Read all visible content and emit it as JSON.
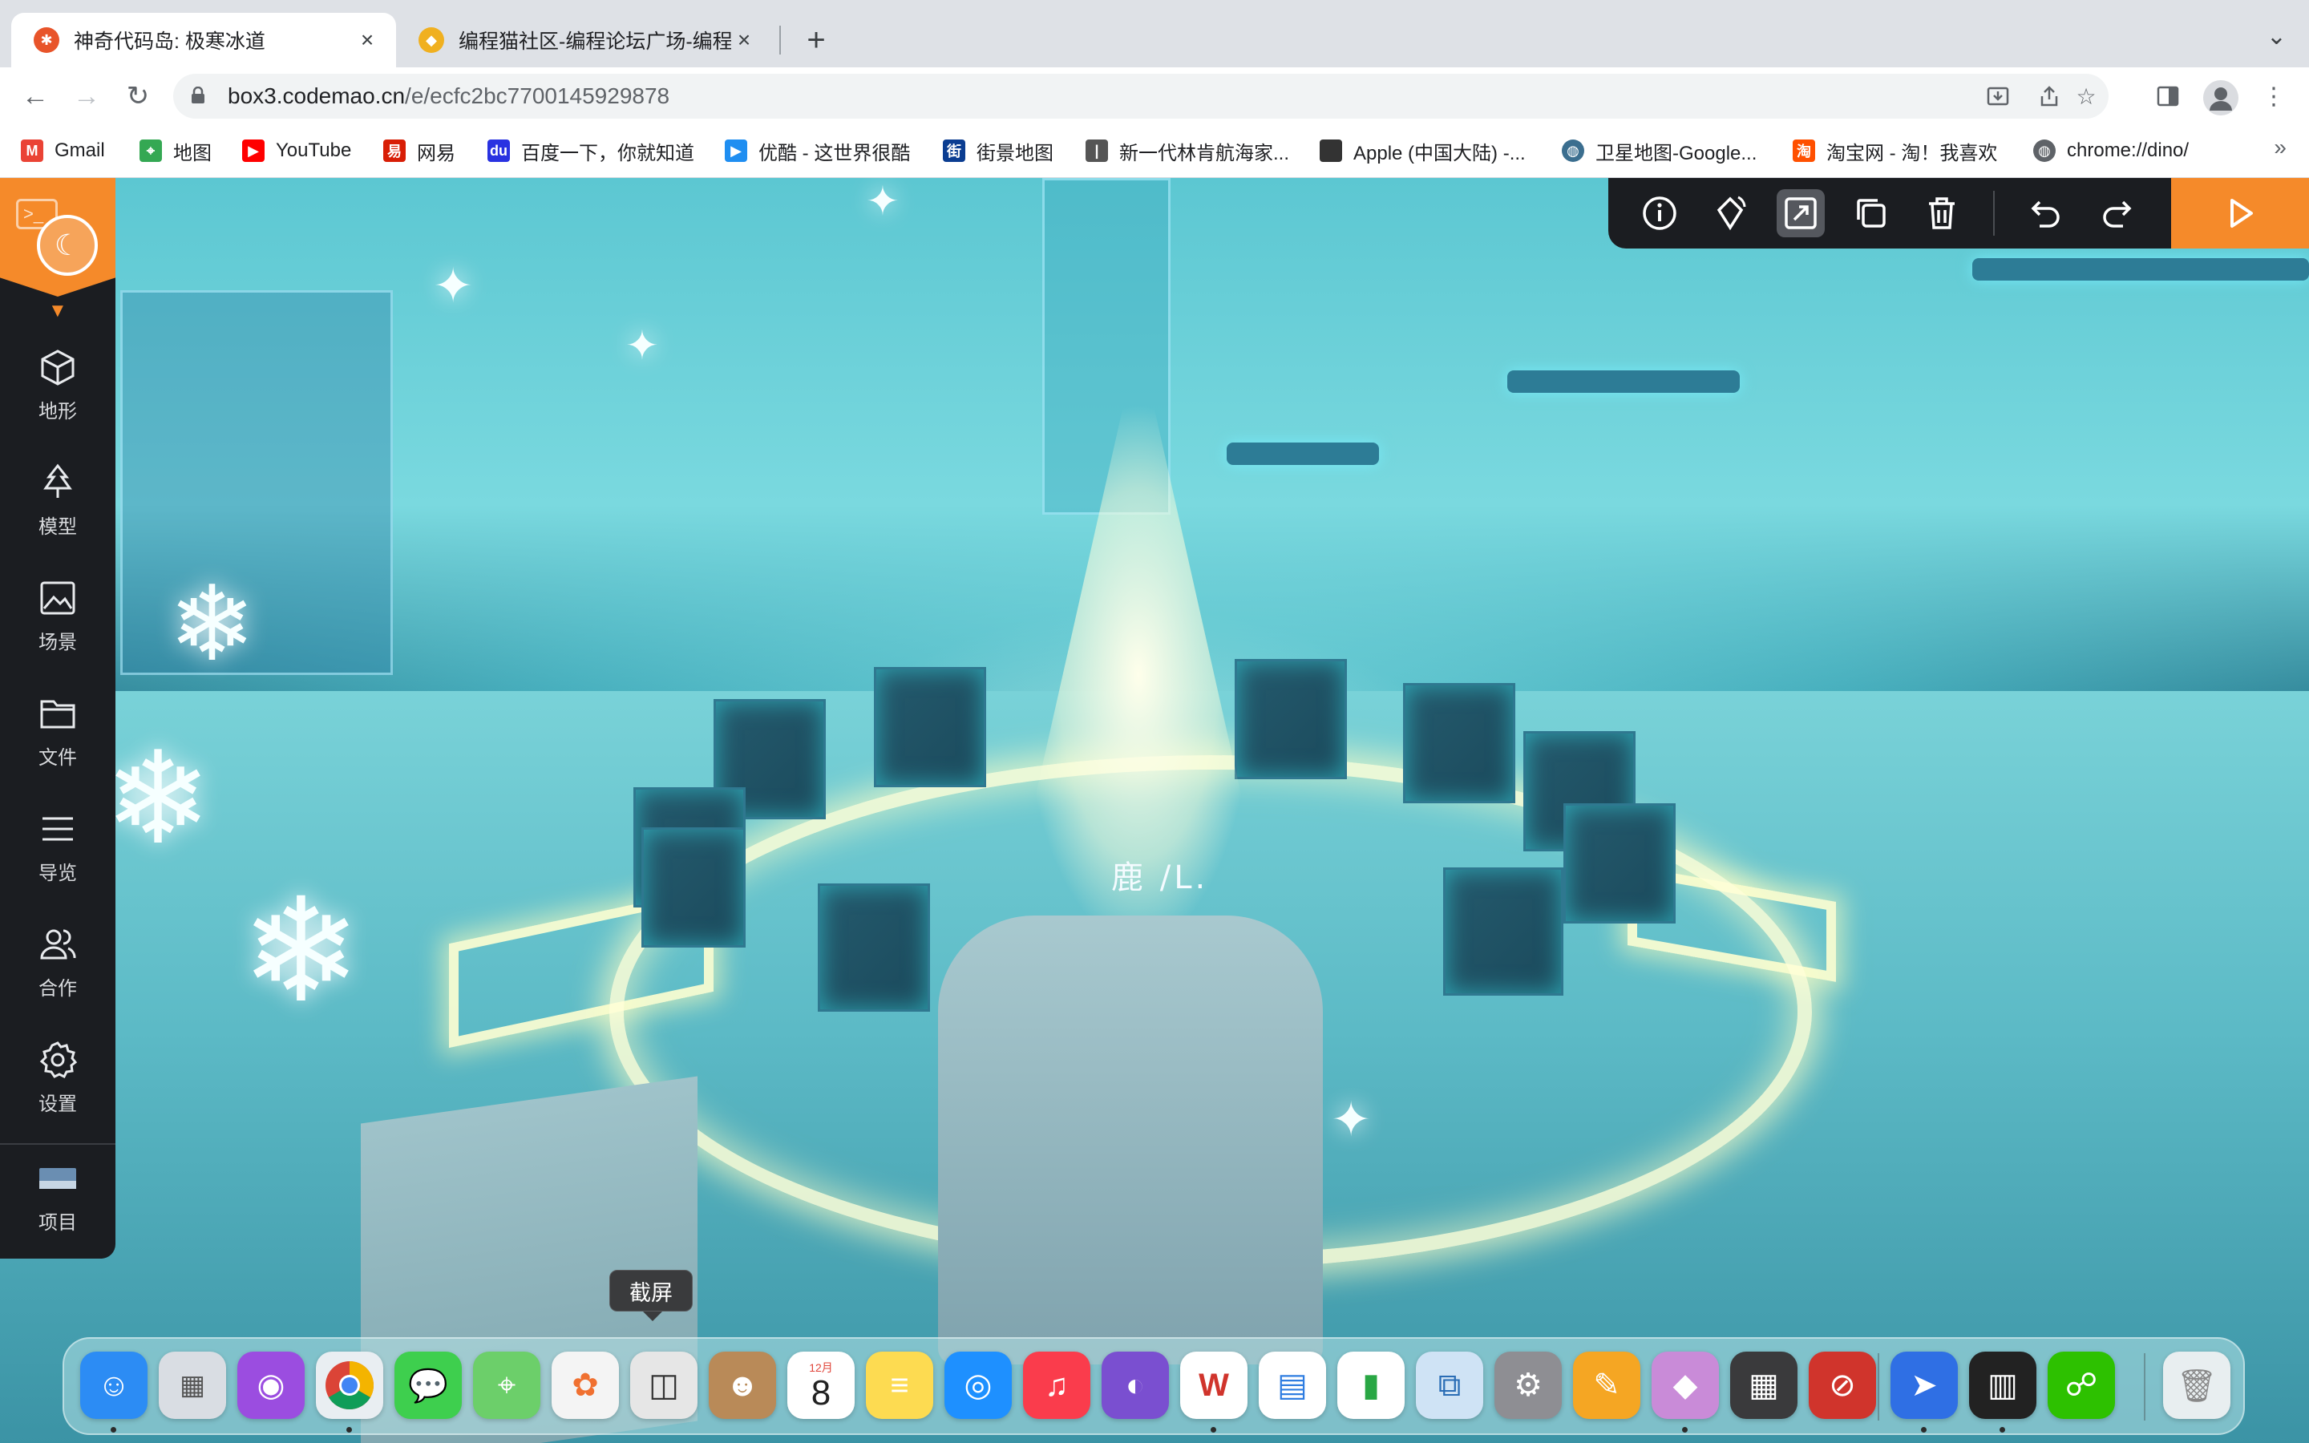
{
  "browser": {
    "tabs": [
      {
        "title": "神奇代码岛: 极寒冰道",
        "active": true,
        "favicon": "codemao-star-icon"
      },
      {
        "title": "编程猫社区-编程论坛广场-编程学",
        "active": false,
        "favicon": "codemao-cat-icon"
      }
    ],
    "new_tab_label": "+",
    "url_host": "box3.codemao.cn",
    "url_path": "/e/ecfc2bc7700145929878",
    "bookmarks": [
      {
        "label": "Gmail",
        "icon": "gmail-icon",
        "color": "#ea4335"
      },
      {
        "label": "地图",
        "icon": "maps-icon",
        "color": "#34a853"
      },
      {
        "label": "YouTube",
        "icon": "youtube-icon",
        "color": "#ff0000"
      },
      {
        "label": "网易",
        "icon": "netease-icon",
        "color": "#d81e06"
      },
      {
        "label": "百度一下，你就知道",
        "icon": "baidu-icon",
        "color": "#2932e1"
      },
      {
        "label": "优酷 - 这世界很酷",
        "icon": "youku-icon",
        "color": "#1f8ef1"
      },
      {
        "label": "街景地图",
        "icon": "street-map-icon",
        "color": "#0b3d91"
      },
      {
        "label": "新一代林肯航海家...",
        "icon": "lincoln-icon",
        "color": "#555555"
      },
      {
        "label": "Apple (中国大陆) -...",
        "icon": "apple-icon",
        "color": "#333333"
      },
      {
        "label": "卫星地图-Google...",
        "icon": "globe-icon",
        "color": "#3b6e8f"
      },
      {
        "label": "淘宝网 - 淘！我喜欢",
        "icon": "taobao-icon",
        "color": "#ff5000"
      },
      {
        "label": "chrome://dino/",
        "icon": "chrome-globe-icon",
        "color": "#5f6368"
      }
    ],
    "bookmarks_more": "»"
  },
  "editor": {
    "rail": [
      {
        "label": "地形",
        "icon": "cube-icon"
      },
      {
        "label": "模型",
        "icon": "tree-icon"
      },
      {
        "label": "场景",
        "icon": "image-icon"
      },
      {
        "label": "文件",
        "icon": "folder-icon"
      },
      {
        "label": "导览",
        "icon": "list-icon"
      },
      {
        "label": "合作",
        "icon": "people-icon"
      },
      {
        "label": "设置",
        "icon": "gear-icon"
      },
      {
        "label": "项目",
        "icon": "project-thumbnail-icon"
      }
    ],
    "toolbar": [
      "info-icon",
      "rotate-icon",
      "resize-icon",
      "duplicate-icon",
      "delete-icon",
      "undo-icon",
      "redo-icon"
    ],
    "play_icon": "play-icon",
    "accent_color": "#f58a2a",
    "panel_color": "#1b1d21"
  },
  "scene": {
    "caption": "鹿 /L."
  },
  "tooltip": "截屏",
  "dock": {
    "apps": [
      {
        "name": "finder",
        "icon": "finder-icon",
        "color": "#2c8cf4",
        "running": true
      },
      {
        "name": "launchpad",
        "icon": "launchpad-icon",
        "color": "#d9dde3",
        "running": false
      },
      {
        "name": "podcasts",
        "icon": "podcasts-icon",
        "color": "#9b4de0",
        "running": false
      },
      {
        "name": "chrome",
        "icon": "chrome-icon",
        "color": "#e9eef2",
        "running": true
      },
      {
        "name": "messages",
        "icon": "messages-icon",
        "color": "#3ecf4e",
        "running": false
      },
      {
        "name": "maps",
        "icon": "maps-app-icon",
        "color": "#6ccf6a",
        "running": false
      },
      {
        "name": "photos",
        "icon": "photos-icon",
        "color": "#f4f4f4",
        "running": false
      },
      {
        "name": "screenshot",
        "icon": "screenshot-icon",
        "color": "#e6e6e6",
        "running": false
      },
      {
        "name": "contacts",
        "icon": "contacts-icon",
        "color": "#b98a58",
        "running": false
      },
      {
        "name": "calendar",
        "icon": "calendar-icon",
        "color": "#ffffff",
        "running": false,
        "month": "12月",
        "day": "8"
      },
      {
        "name": "notes",
        "icon": "notes-icon",
        "color": "#fddb51",
        "running": false
      },
      {
        "name": "safari",
        "icon": "safari-icon",
        "color": "#1e90ff",
        "running": false
      },
      {
        "name": "music",
        "icon": "music-icon",
        "color": "#fa3c4c",
        "running": false
      },
      {
        "name": "instruments",
        "icon": "instruments-icon",
        "color": "#7a4fd0",
        "running": false
      },
      {
        "name": "wps",
        "icon": "wps-icon",
        "color": "#ffffff",
        "running": true
      },
      {
        "name": "keynote",
        "icon": "keynote-icon",
        "color": "#ffffff",
        "running": false
      },
      {
        "name": "numbers",
        "icon": "numbers-icon",
        "color": "#ffffff",
        "running": false
      },
      {
        "name": "screen-sharing",
        "icon": "screen-sharing-icon",
        "color": "#cfe3f5",
        "running": false
      },
      {
        "name": "system-preferences",
        "icon": "system-preferences-icon",
        "color": "#8e8e93",
        "running": false
      },
      {
        "name": "pages",
        "icon": "pages-icon",
        "color": "#f5a623",
        "running": false
      },
      {
        "name": "magicavoxel",
        "icon": "voxel-icon",
        "color": "#c98bd8",
        "running": true
      },
      {
        "name": "calculator",
        "icon": "calculator-icon",
        "color": "#3a3a3c",
        "running": false
      },
      {
        "name": "digital-color-meter",
        "icon": "compass-icon",
        "color": "#d0342c",
        "running": false
      },
      {
        "name": "testflight",
        "icon": "paper-plane-icon",
        "color": "#2f6fe4",
        "running": true
      },
      {
        "name": "garageband",
        "icon": "piano-icon",
        "color": "#222222",
        "running": true
      },
      {
        "name": "wechat",
        "icon": "wechat-icon",
        "color": "#2dc100",
        "running": false
      },
      {
        "name": "trash",
        "icon": "trash-icon",
        "color": "#e8eef0",
        "running": false
      }
    ]
  }
}
